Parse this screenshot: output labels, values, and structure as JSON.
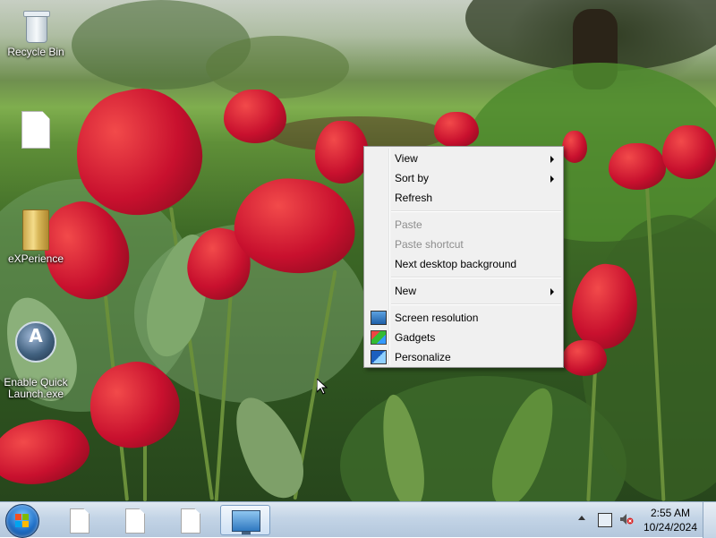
{
  "desktop_icons": [
    {
      "label": "Recycle Bin",
      "icon": "recycle-bin-icon"
    },
    {
      "label": "",
      "icon": "document-icon"
    },
    {
      "label": "eXPerience",
      "icon": "folder-icon"
    },
    {
      "label": "Enable Quick\nLaunch.exe",
      "icon": "quick-launch-icon"
    }
  ],
  "context_menu": {
    "items": [
      {
        "label": "View",
        "submenu": true,
        "enabled": true
      },
      {
        "label": "Sort by",
        "submenu": true,
        "enabled": true
      },
      {
        "label": "Refresh",
        "submenu": false,
        "enabled": true
      },
      {
        "label": "Paste",
        "submenu": false,
        "enabled": false
      },
      {
        "label": "Paste shortcut",
        "submenu": false,
        "enabled": false
      },
      {
        "label": "Next desktop background",
        "submenu": false,
        "enabled": true
      },
      {
        "label": "New",
        "submenu": true,
        "enabled": true
      },
      {
        "label": "Screen resolution",
        "submenu": false,
        "enabled": true,
        "icon": "monitor-icon"
      },
      {
        "label": "Gadgets",
        "submenu": false,
        "enabled": true,
        "icon": "gadgets-icon"
      },
      {
        "label": "Personalize",
        "submenu": false,
        "enabled": true,
        "icon": "personalize-icon"
      }
    ]
  },
  "taskbar": {
    "start_icon": "windows-logo-icon",
    "buttons": [
      {
        "icon": "document-icon",
        "active": false
      },
      {
        "icon": "document-icon",
        "active": false
      },
      {
        "icon": "document-icon",
        "active": false
      },
      {
        "icon": "display-settings-icon",
        "active": true
      }
    ],
    "tray": {
      "icons": [
        "show-hidden-icons-arrow",
        "network-icon",
        "volume-muted-icon"
      ],
      "time": "2:55 AM",
      "date": "10/24/2024"
    }
  },
  "colors": {
    "taskbar_top": "#dfe8f1",
    "menu_background": "#f0f0f0",
    "disabled_text": "#8d8d8d",
    "tulip_red": "#c8102e"
  }
}
